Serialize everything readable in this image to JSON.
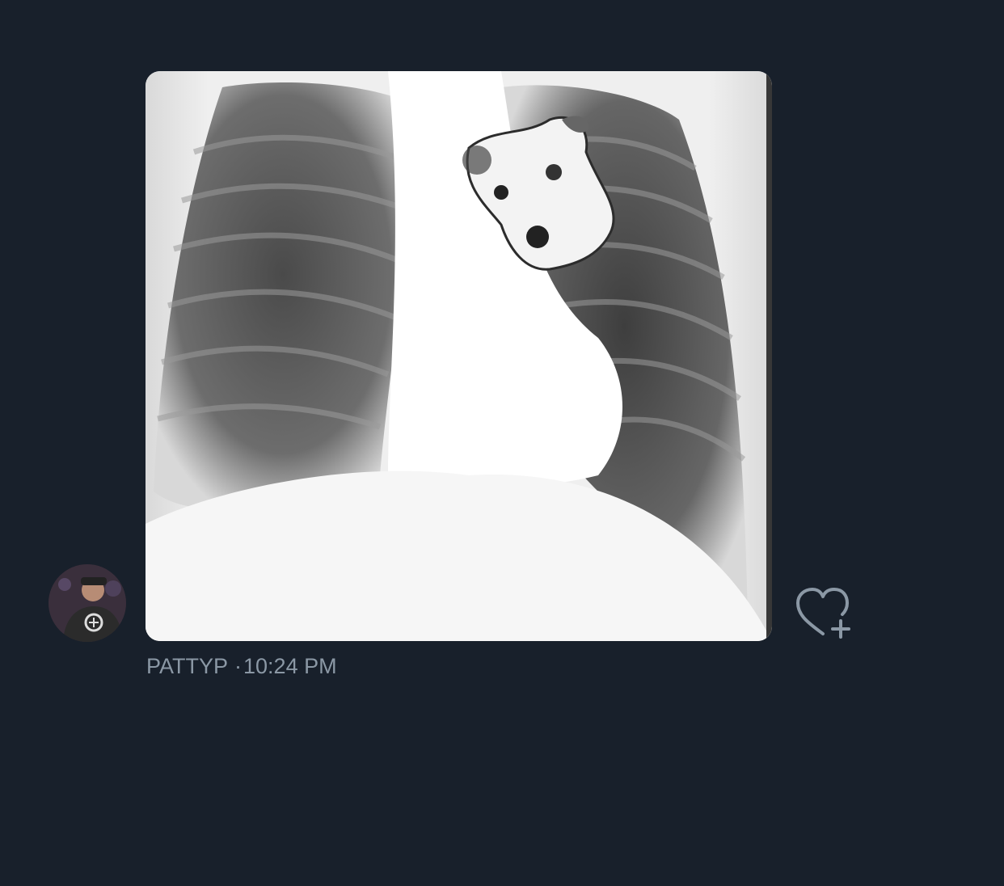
{
  "message": {
    "sender": "PATTYP",
    "separator": "·",
    "time": "10:24 PM"
  },
  "icons": {
    "avatar": "user-avatar",
    "like": "heart-plus-icon"
  },
  "colors": {
    "background": "#18202b",
    "meta_text": "#8b98a5",
    "icon_stroke": "#8b98a5"
  }
}
